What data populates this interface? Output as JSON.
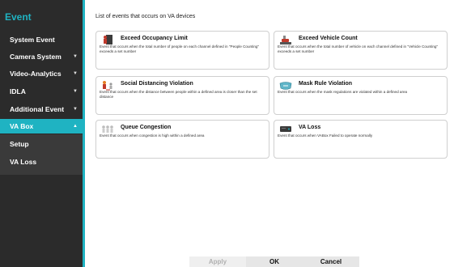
{
  "sidebar": {
    "header": "Event",
    "items": [
      {
        "label": "System Event",
        "chevron": false
      },
      {
        "label": "Camera System",
        "chevron": true
      },
      {
        "label": "Video-Analytics",
        "chevron": true
      },
      {
        "label": "IDLA",
        "chevron": true
      },
      {
        "label": "Additional Event",
        "chevron": true
      },
      {
        "label": "VA Box",
        "chevron": true,
        "active": true
      },
      {
        "label": "Setup"
      },
      {
        "label": "VA Loss"
      }
    ],
    "chevron_down": "▼",
    "chevron_up": "▲"
  },
  "main": {
    "title": "List of events that occurs on VA devices",
    "cards": [
      {
        "title": "Exceed Occupancy Limit",
        "icon": "people-counting-icon",
        "desc": "Event that occurs when the total number of people on each channel defined in \"People Counting\" exceeds a set number"
      },
      {
        "title": "Exceed Vehicle Count",
        "icon": "vehicle-count-icon",
        "desc": "Event that occurs when the total number of vehicle on each channel defined in \"Vehicle Counting\" exceeds a set number"
      },
      {
        "title": "Social Distancing Violation",
        "icon": "social-distancing-icon",
        "desc": "Event that occurs when the distance between people within a defined area is closer than the set distance"
      },
      {
        "title": "Mask Rule Violation",
        "icon": "mask-icon",
        "desc": "Event that occurs when the mask regulations are violated within a defined area"
      },
      {
        "title": "Queue Congestion",
        "icon": "queue-icon",
        "desc": "Event that occurs when congestion is high within a defined area"
      },
      {
        "title": "VA Loss",
        "icon": "va-box-device-icon",
        "desc": "Event that occurs when VABox Failed to operate normally"
      }
    ]
  },
  "footer": {
    "apply": "Apply",
    "ok": "OK",
    "cancel": "Cancel"
  },
  "colors": {
    "accent": "#1fb3c2",
    "sidebar_bg": "#2b2b2b"
  }
}
